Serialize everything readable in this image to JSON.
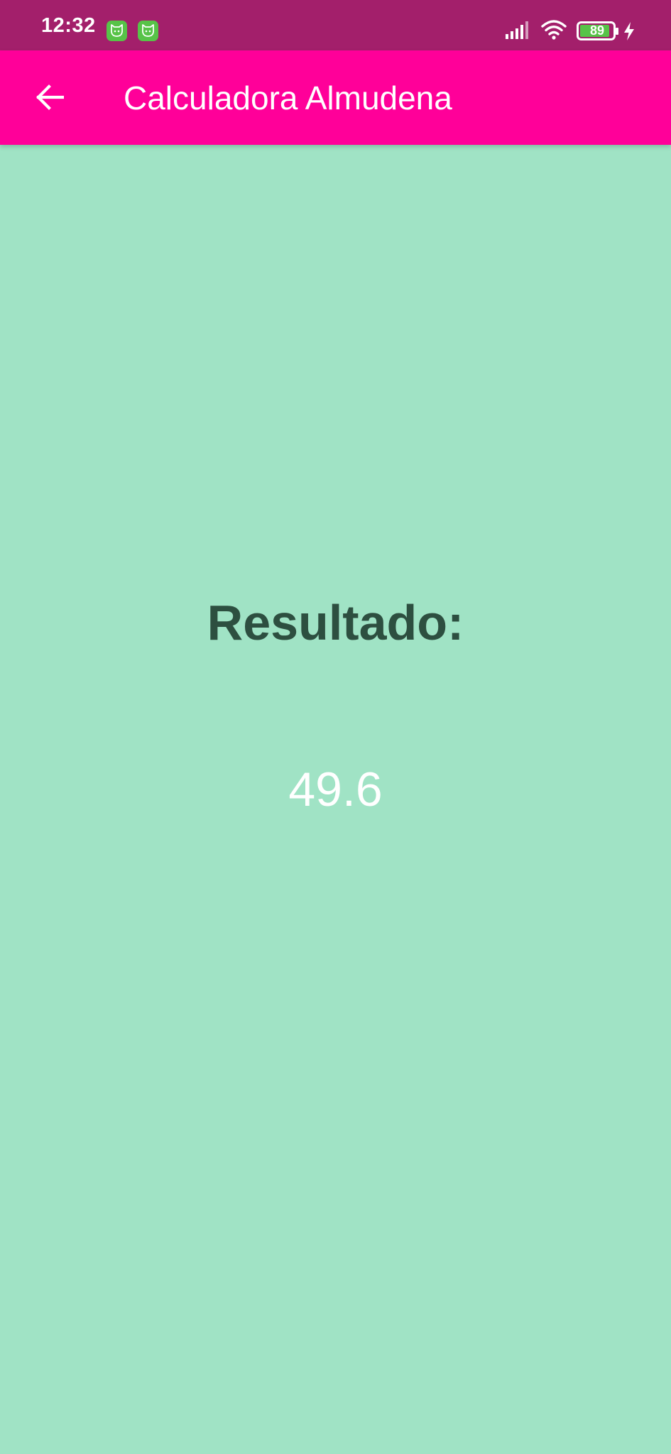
{
  "status_bar": {
    "time": "12:32",
    "battery_level": "89",
    "notification_icons": [
      "cat-app-icon",
      "cat-app-icon"
    ],
    "icons": [
      "signal-icon",
      "wifi-icon",
      "battery-icon",
      "charging-icon"
    ]
  },
  "app_bar": {
    "title": "Calculadora Almudena",
    "back_icon": "arrow-left-icon",
    "background_color": "#FF0099"
  },
  "content": {
    "result_label": "Resultado:",
    "result_value": "49.6",
    "background_color": "#A0E3C5",
    "label_color": "#2D4F40"
  },
  "colors": {
    "status_bar": "#A31F6B",
    "notification_icon": "#57C348"
  }
}
